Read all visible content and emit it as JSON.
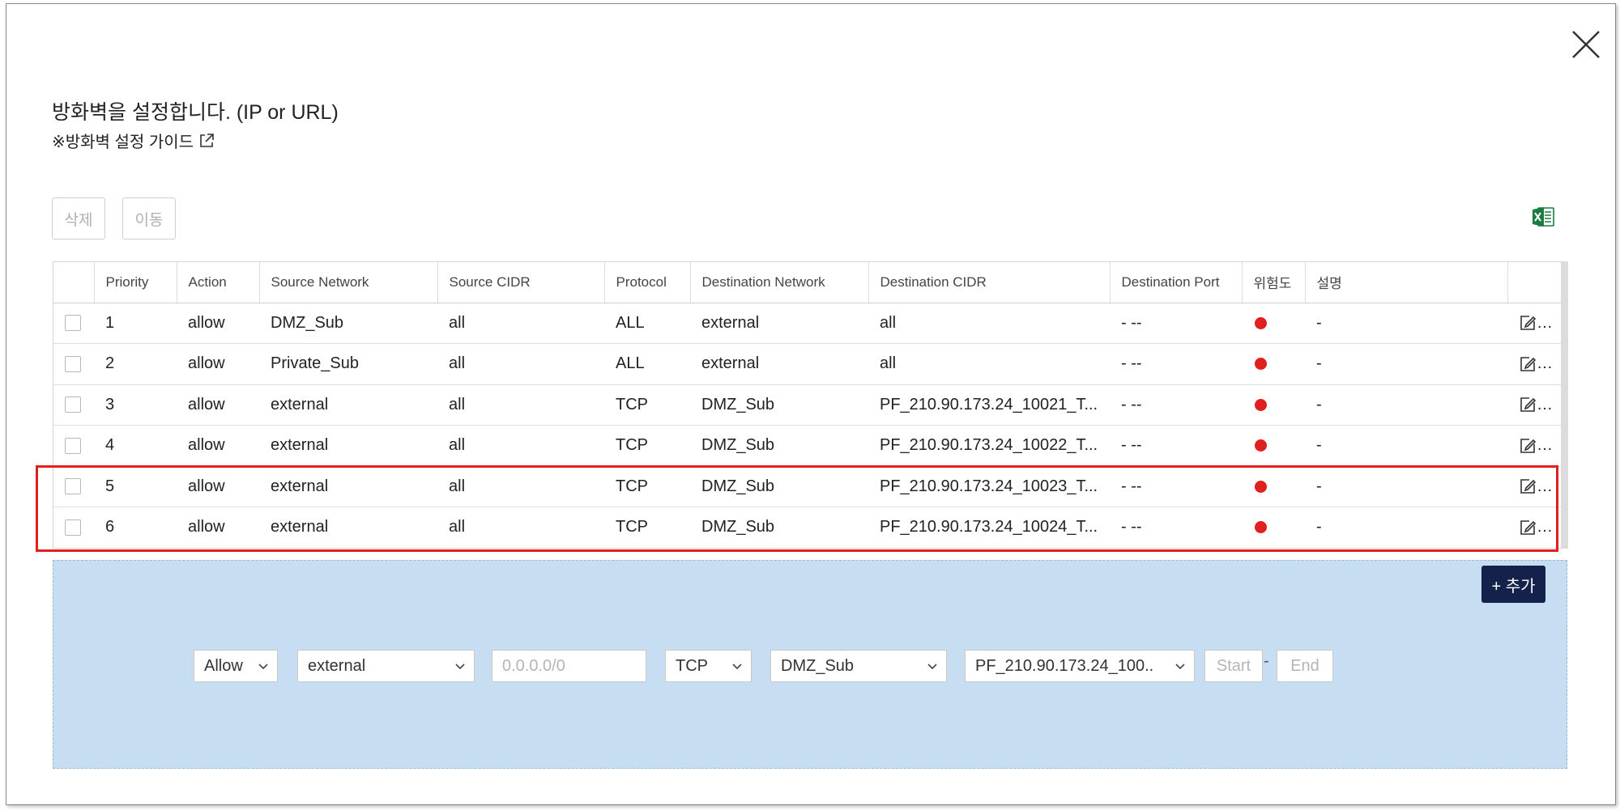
{
  "dialog": {
    "title": "방화벽을 설정합니다. (IP or URL)",
    "guide_link": "※방화벽 설정 가이드"
  },
  "toolbar": {
    "delete_label": "삭제",
    "move_label": "이동"
  },
  "table": {
    "headers": {
      "priority": "Priority",
      "action": "Action",
      "source_network": "Source Network",
      "source_cidr": "Source CIDR",
      "protocol": "Protocol",
      "destination_network": "Destination Network",
      "destination_cidr": "Destination CIDR",
      "destination_port": "Destination Port",
      "risk": "위험도",
      "description": "설명"
    },
    "rows": [
      {
        "priority": "1",
        "action": "allow",
        "source_network": "DMZ_Sub",
        "source_cidr": "all",
        "protocol": "ALL",
        "destination_network": "external",
        "destination_cidr": "all",
        "destination_port": "- --",
        "description": "-"
      },
      {
        "priority": "2",
        "action": "allow",
        "source_network": "Private_Sub",
        "source_cidr": "all",
        "protocol": "ALL",
        "destination_network": "external",
        "destination_cidr": "all",
        "destination_port": "- --",
        "description": "-"
      },
      {
        "priority": "3",
        "action": "allow",
        "source_network": "external",
        "source_cidr": "all",
        "protocol": "TCP",
        "destination_network": "DMZ_Sub",
        "destination_cidr": "PF_210.90.173.24_10021_T...",
        "destination_port": "- --",
        "description": "-"
      },
      {
        "priority": "4",
        "action": "allow",
        "source_network": "external",
        "source_cidr": "all",
        "protocol": "TCP",
        "destination_network": "DMZ_Sub",
        "destination_cidr": "PF_210.90.173.24_10022_T...",
        "destination_port": "- --",
        "description": "-"
      },
      {
        "priority": "5",
        "action": "allow",
        "source_network": "external",
        "source_cidr": "all",
        "protocol": "TCP",
        "destination_network": "DMZ_Sub",
        "destination_cidr": "PF_210.90.173.24_10023_T...",
        "destination_port": "- --",
        "description": "-"
      },
      {
        "priority": "6",
        "action": "allow",
        "source_network": "external",
        "source_cidr": "all",
        "protocol": "TCP",
        "destination_network": "DMZ_Sub",
        "destination_cidr": "PF_210.90.173.24_10024_T...",
        "destination_port": "- --",
        "description": "-"
      }
    ]
  },
  "add_form": {
    "add_button_label": "+ 추가",
    "action_value": "Allow",
    "source_network_value": "external",
    "source_cidr_placeholder": "0.0.0.0/0",
    "protocol_value": "TCP",
    "destination_network_value": "DMZ_Sub",
    "destination_cidr_value": "PF_210.90.173.24_100..",
    "port_separator": "-",
    "start_port_placeholder": "Start",
    "end_port_placeholder": "End"
  },
  "colors": {
    "risk_high": "#e01f1f",
    "add_button_bg": "#14214b",
    "add_panel_bg": "#c6ddf2",
    "highlight_border": "#e01f1f",
    "excel_green": "#1d7a3e"
  }
}
